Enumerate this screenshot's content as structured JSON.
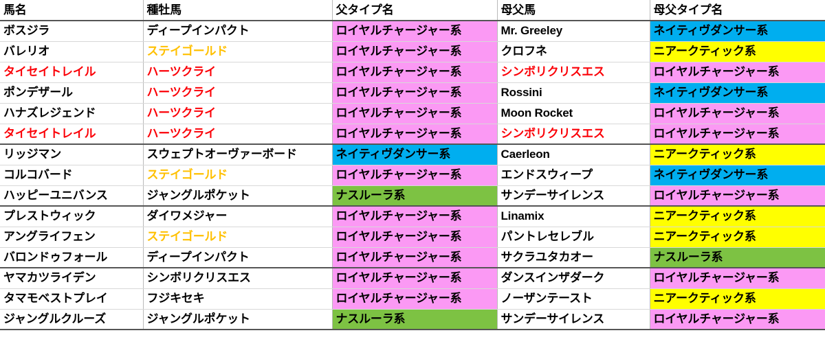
{
  "table": {
    "name": "pedigree-sire-line-table",
    "columns": [
      {
        "key": "horse",
        "label": "馬名"
      },
      {
        "key": "sire",
        "label": "種牡馬"
      },
      {
        "key": "sire_type",
        "label": "父タイプ名"
      },
      {
        "key": "broodmare_sire",
        "label": "母父馬"
      },
      {
        "key": "bms_type",
        "label": "母父タイプ名"
      }
    ],
    "colors": {
      "pink": "#fb99f4",
      "cyan": "#00aeef",
      "yellow": "#ffff00",
      "green": "#7dc243",
      "red_text": "#fb0007",
      "orange_text": "#ffc000",
      "black_text": "#000000",
      "grid_line": "#d8d8d8",
      "group_line": "#555555"
    },
    "rows": [
      {
        "group_end": false,
        "cells": [
          {
            "text": "ボスジラ",
            "fill": "none",
            "color": "black",
            "latin": false
          },
          {
            "text": "ディープインパクト",
            "fill": "none",
            "color": "black",
            "latin": false
          },
          {
            "text": "ロイヤルチャージャー系",
            "fill": "pink",
            "color": "black",
            "latin": false
          },
          {
            "text": "Mr. Greeley",
            "fill": "none",
            "color": "black",
            "latin": true
          },
          {
            "text": "ネイティヴダンサー系",
            "fill": "cyan",
            "color": "black",
            "latin": false
          }
        ]
      },
      {
        "group_end": false,
        "cells": [
          {
            "text": "バレリオ",
            "fill": "none",
            "color": "black",
            "latin": false
          },
          {
            "text": "ステイゴールド",
            "fill": "none",
            "color": "orange",
            "latin": false
          },
          {
            "text": "ロイヤルチャージャー系",
            "fill": "pink",
            "color": "black",
            "latin": false
          },
          {
            "text": "クロフネ",
            "fill": "none",
            "color": "black",
            "latin": false
          },
          {
            "text": "ニアークティック系",
            "fill": "yellow",
            "color": "black",
            "latin": false
          }
        ]
      },
      {
        "group_end": false,
        "cells": [
          {
            "text": "タイセイトレイル",
            "fill": "none",
            "color": "red",
            "latin": false
          },
          {
            "text": "ハーツクライ",
            "fill": "none",
            "color": "red",
            "latin": false
          },
          {
            "text": "ロイヤルチャージャー系",
            "fill": "pink",
            "color": "black",
            "latin": false
          },
          {
            "text": "シンボリクリスエス",
            "fill": "none",
            "color": "red",
            "latin": false
          },
          {
            "text": "ロイヤルチャージャー系",
            "fill": "pink",
            "color": "black",
            "latin": false
          }
        ]
      },
      {
        "group_end": false,
        "cells": [
          {
            "text": "ポンデザール",
            "fill": "none",
            "color": "black",
            "latin": false
          },
          {
            "text": "ハーツクライ",
            "fill": "none",
            "color": "red",
            "latin": false
          },
          {
            "text": "ロイヤルチャージャー系",
            "fill": "pink",
            "color": "black",
            "latin": false
          },
          {
            "text": "Rossini",
            "fill": "none",
            "color": "black",
            "latin": true
          },
          {
            "text": "ネイティヴダンサー系",
            "fill": "cyan",
            "color": "black",
            "latin": false
          }
        ]
      },
      {
        "group_end": false,
        "cells": [
          {
            "text": "ハナズレジェンド",
            "fill": "none",
            "color": "black",
            "latin": false
          },
          {
            "text": "ハーツクライ",
            "fill": "none",
            "color": "red",
            "latin": false
          },
          {
            "text": "ロイヤルチャージャー系",
            "fill": "pink",
            "color": "black",
            "latin": false
          },
          {
            "text": "Moon Rocket",
            "fill": "none",
            "color": "black",
            "latin": true
          },
          {
            "text": "ロイヤルチャージャー系",
            "fill": "pink",
            "color": "black",
            "latin": false
          }
        ]
      },
      {
        "group_end": true,
        "cells": [
          {
            "text": "タイセイトレイル",
            "fill": "none",
            "color": "red",
            "latin": false
          },
          {
            "text": "ハーツクライ",
            "fill": "none",
            "color": "red",
            "latin": false
          },
          {
            "text": "ロイヤルチャージャー系",
            "fill": "pink",
            "color": "black",
            "latin": false
          },
          {
            "text": "シンボリクリスエス",
            "fill": "none",
            "color": "red",
            "latin": false
          },
          {
            "text": "ロイヤルチャージャー系",
            "fill": "pink",
            "color": "black",
            "latin": false
          }
        ]
      },
      {
        "group_end": false,
        "cells": [
          {
            "text": "リッジマン",
            "fill": "none",
            "color": "black",
            "latin": false
          },
          {
            "text": "スウェプトオーヴァーボード",
            "fill": "none",
            "color": "black",
            "latin": false
          },
          {
            "text": "ネイティヴダンサー系",
            "fill": "cyan",
            "color": "black",
            "latin": false
          },
          {
            "text": "Caerleon",
            "fill": "none",
            "color": "black",
            "latin": true
          },
          {
            "text": "ニアークティック系",
            "fill": "yellow",
            "color": "black",
            "latin": false
          }
        ]
      },
      {
        "group_end": false,
        "cells": [
          {
            "text": "コルコバード",
            "fill": "none",
            "color": "black",
            "latin": false
          },
          {
            "text": "ステイゴールド",
            "fill": "none",
            "color": "orange",
            "latin": false
          },
          {
            "text": "ロイヤルチャージャー系",
            "fill": "pink",
            "color": "black",
            "latin": false
          },
          {
            "text": "エンドスウィープ",
            "fill": "none",
            "color": "black",
            "latin": false
          },
          {
            "text": "ネイティヴダンサー系",
            "fill": "cyan",
            "color": "black",
            "latin": false
          }
        ]
      },
      {
        "group_end": true,
        "cells": [
          {
            "text": "ハッピーユニバンス",
            "fill": "none",
            "color": "black",
            "latin": false
          },
          {
            "text": "ジャングルポケット",
            "fill": "none",
            "color": "black",
            "latin": false
          },
          {
            "text": "ナスルーラ系",
            "fill": "green",
            "color": "black",
            "latin": false
          },
          {
            "text": "サンデーサイレンス",
            "fill": "none",
            "color": "black",
            "latin": false
          },
          {
            "text": "ロイヤルチャージャー系",
            "fill": "pink",
            "color": "black",
            "latin": false
          }
        ]
      },
      {
        "group_end": false,
        "cells": [
          {
            "text": "プレストウィック",
            "fill": "none",
            "color": "black",
            "latin": false
          },
          {
            "text": "ダイワメジャー",
            "fill": "none",
            "color": "black",
            "latin": false
          },
          {
            "text": "ロイヤルチャージャー系",
            "fill": "pink",
            "color": "black",
            "latin": false
          },
          {
            "text": "Linamix",
            "fill": "none",
            "color": "black",
            "latin": true
          },
          {
            "text": "ニアークティック系",
            "fill": "yellow",
            "color": "black",
            "latin": false
          }
        ]
      },
      {
        "group_end": false,
        "cells": [
          {
            "text": "アングライフェン",
            "fill": "none",
            "color": "black",
            "latin": false
          },
          {
            "text": "ステイゴールド",
            "fill": "none",
            "color": "orange",
            "latin": false
          },
          {
            "text": "ロイヤルチャージャー系",
            "fill": "pink",
            "color": "black",
            "latin": false
          },
          {
            "text": "パントレセレブル",
            "fill": "none",
            "color": "black",
            "latin": false
          },
          {
            "text": "ニアークティック系",
            "fill": "yellow",
            "color": "black",
            "latin": false
          }
        ]
      },
      {
        "group_end": true,
        "cells": [
          {
            "text": "バロンドゥフォール",
            "fill": "none",
            "color": "black",
            "latin": false
          },
          {
            "text": "ディープインパクト",
            "fill": "none",
            "color": "black",
            "latin": false
          },
          {
            "text": "ロイヤルチャージャー系",
            "fill": "pink",
            "color": "black",
            "latin": false
          },
          {
            "text": "サクラユタカオー",
            "fill": "none",
            "color": "black",
            "latin": false
          },
          {
            "text": "ナスルーラ系",
            "fill": "green",
            "color": "black",
            "latin": false
          }
        ]
      },
      {
        "group_end": false,
        "cells": [
          {
            "text": "ヤマカツライデン",
            "fill": "none",
            "color": "black",
            "latin": false
          },
          {
            "text": "シンボリクリスエス",
            "fill": "none",
            "color": "black",
            "latin": false
          },
          {
            "text": "ロイヤルチャージャー系",
            "fill": "pink",
            "color": "black",
            "latin": false
          },
          {
            "text": "ダンスインザダーク",
            "fill": "none",
            "color": "black",
            "latin": false
          },
          {
            "text": "ロイヤルチャージャー系",
            "fill": "pink",
            "color": "black",
            "latin": false
          }
        ]
      },
      {
        "group_end": false,
        "cells": [
          {
            "text": "タマモベストプレイ",
            "fill": "none",
            "color": "black",
            "latin": false
          },
          {
            "text": "フジキセキ",
            "fill": "none",
            "color": "black",
            "latin": false
          },
          {
            "text": "ロイヤルチャージャー系",
            "fill": "pink",
            "color": "black",
            "latin": false
          },
          {
            "text": "ノーザンテースト",
            "fill": "none",
            "color": "black",
            "latin": false
          },
          {
            "text": "ニアークティック系",
            "fill": "yellow",
            "color": "black",
            "latin": false
          }
        ]
      },
      {
        "group_end": false,
        "cells": [
          {
            "text": "ジャングルクルーズ",
            "fill": "none",
            "color": "black",
            "latin": false
          },
          {
            "text": "ジャングルポケット",
            "fill": "none",
            "color": "black",
            "latin": false
          },
          {
            "text": "ナスルーラ系",
            "fill": "green",
            "color": "black",
            "latin": false
          },
          {
            "text": "サンデーサイレンス",
            "fill": "none",
            "color": "black",
            "latin": false
          },
          {
            "text": "ロイヤルチャージャー系",
            "fill": "pink",
            "color": "black",
            "latin": false
          }
        ]
      }
    ]
  }
}
